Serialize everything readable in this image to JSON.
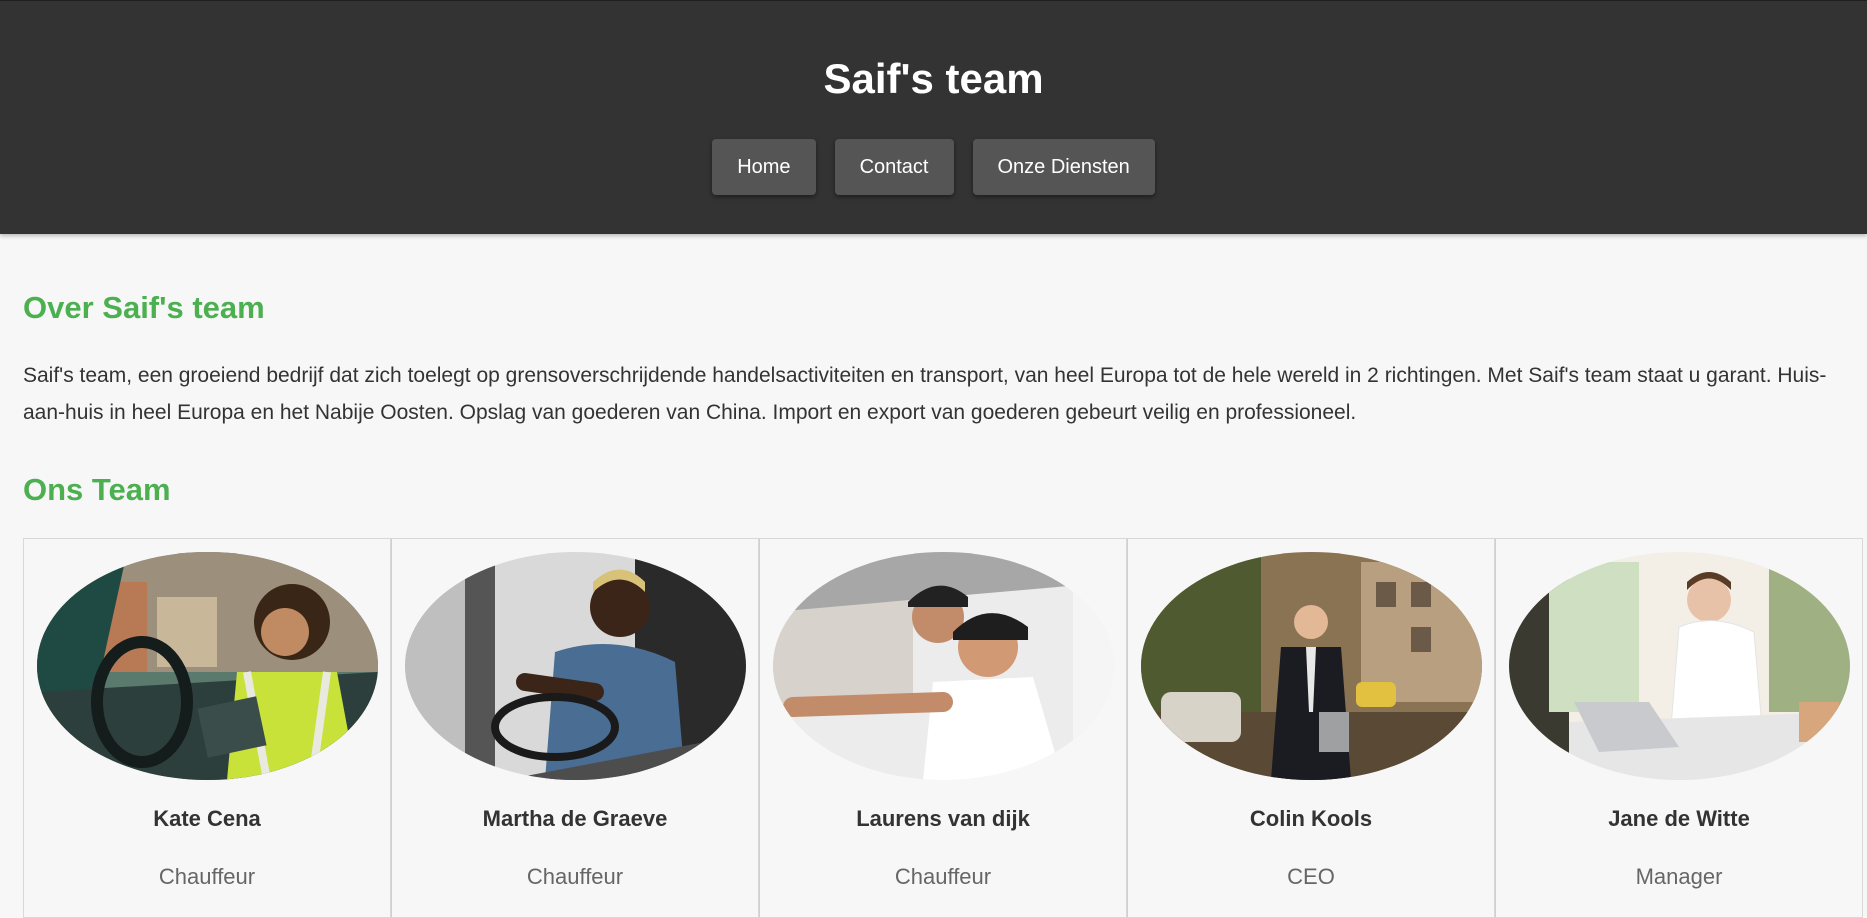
{
  "header": {
    "title": "Saif's team",
    "nav": [
      "Home",
      "Contact",
      "Onze Diensten"
    ]
  },
  "about": {
    "heading": "Over Saif's team",
    "text": "Saif's team, een groeiend bedrijf dat zich toelegt op grensoverschrijdende handelsactiviteiten en transport, van heel Europa tot de hele wereld in 2 richtingen. Met Saif's team staat u garant. Huis-aan-huis in heel Europa en het Nabije Oosten. Opslag van goederen van China. Import en export van goederen gebeurt veilig en professioneel."
  },
  "team": {
    "heading": "Ons Team",
    "members": [
      {
        "name": "Kate Cena",
        "role": "Chauffeur"
      },
      {
        "name": "Martha de Graeve",
        "role": "Chauffeur"
      },
      {
        "name": "Laurens van dijk",
        "role": "Chauffeur"
      },
      {
        "name": "Colin Kools",
        "role": "CEO"
      },
      {
        "name": "Jane de Witte",
        "role": "Manager"
      }
    ]
  },
  "colors": {
    "header_bg": "#333333",
    "nav_button_bg": "#555555",
    "accent": "#4caf50",
    "page_bg": "#f7f7f7"
  }
}
